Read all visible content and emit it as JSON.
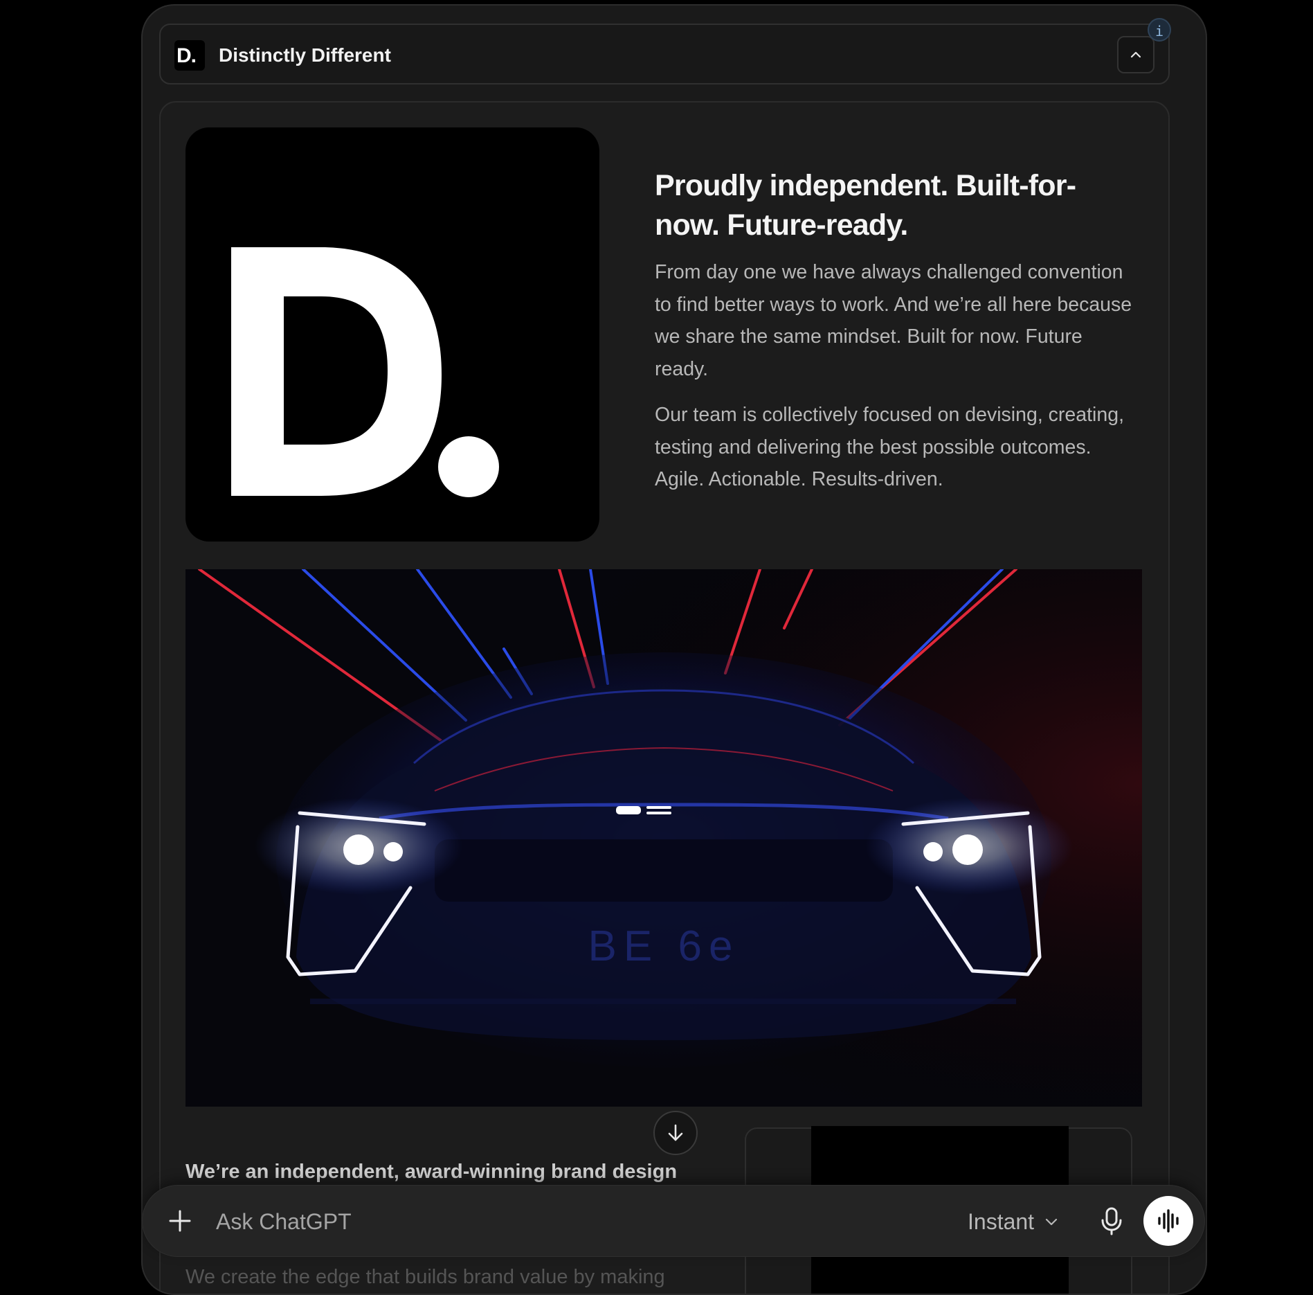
{
  "header": {
    "logo_text": "D.",
    "title": "Distinctly Different",
    "info_label": "i"
  },
  "hero": {
    "logo_text": "D.",
    "headline": "Proudly independent. Built-for-now. Future-ready.",
    "paragraphs": [
      "From day one we have always challenged convention to find better ways to work. And we’re all here because we share the same mindset. Built for now. Future ready.",
      "Our team is collectively focused on devising, creating, testing and delivering the best possible outcomes. Agile. Actionable. Results-driven."
    ]
  },
  "showcase": {
    "image_description_icon": "car-headlights-image",
    "badge_text": "BE 6e"
  },
  "intro": {
    "text": "We’re an independent, award-winning brand design",
    "faded_text": "We create the edge that builds brand value by making"
  },
  "composer": {
    "placeholder": "Ask ChatGPT",
    "model_label": "Instant"
  },
  "icons": {
    "collapse": "chevron-up-icon",
    "scroll": "arrow-down-icon",
    "add": "plus-icon",
    "model_dropdown": "chevron-down-icon",
    "mic": "microphone-icon",
    "voice": "voice-waveform-icon"
  }
}
